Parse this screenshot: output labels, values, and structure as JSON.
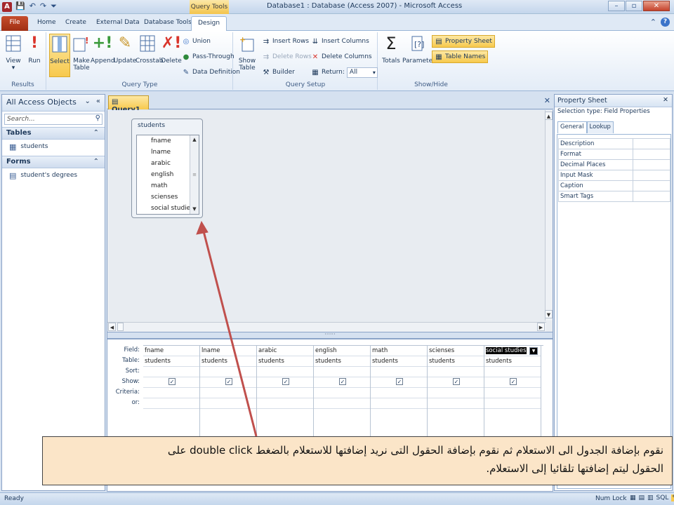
{
  "titlebar": {
    "app_icon": "A",
    "contextual_tab": "Query Tools",
    "title": "Database1 : Database (Access 2007)  -  Microsoft Access",
    "minimize": "–",
    "maximize": "▫",
    "close": "✕"
  },
  "tabs": {
    "file": "File",
    "home": "Home",
    "create": "Create",
    "external": "External Data",
    "dbtools": "Database Tools",
    "design": "Design"
  },
  "ribbon": {
    "results": {
      "label": "Results",
      "view": "View",
      "run": "Run"
    },
    "query_type": {
      "label": "Query Type",
      "select": "Select",
      "make_table_1": "Make",
      "make_table_2": "Table",
      "append": "Append",
      "update": "Update",
      "crosstab": "Crosstab",
      "delete": "Delete",
      "union": "Union",
      "pass_through": "Pass-Through",
      "data_definition": "Data Definition"
    },
    "query_setup": {
      "label": "Query Setup",
      "show_table_1": "Show",
      "show_table_2": "Table",
      "insert_rows": "Insert Rows",
      "delete_rows": "Delete Rows",
      "builder": "Builder",
      "insert_columns": "Insert Columns",
      "delete_columns": "Delete Columns",
      "return_label": "Return:",
      "return_value": "All"
    },
    "show_hide": {
      "label": "Show/Hide",
      "totals": "Totals",
      "parameters": "Parameters",
      "property_sheet": "Property Sheet",
      "table_names": "Table Names"
    }
  },
  "nav": {
    "title": "All Access Objects",
    "search_placeholder": "Search...",
    "groups": [
      {
        "name": "Tables",
        "items": [
          "students"
        ]
      },
      {
        "name": "Forms",
        "items": [
          "student's degrees"
        ]
      }
    ]
  },
  "query": {
    "tab_label": "Query1",
    "table_name": "students",
    "fields": [
      "fname",
      "lname",
      "arabic",
      "english",
      "math",
      "scienses",
      "social studies"
    ],
    "row_labels": [
      "Field:",
      "Table:",
      "Sort:",
      "Show:",
      "Criteria:",
      "or:"
    ],
    "columns": [
      {
        "field": "fname",
        "table": "students",
        "show": true
      },
      {
        "field": "lname",
        "table": "students",
        "show": true
      },
      {
        "field": "arabic",
        "table": "students",
        "show": true
      },
      {
        "field": "english",
        "table": "students",
        "show": true
      },
      {
        "field": "math",
        "table": "students",
        "show": true
      },
      {
        "field": "scienses",
        "table": "students",
        "show": true
      },
      {
        "field": "social studies",
        "table": "students",
        "show": true
      }
    ],
    "check_mark": "✓"
  },
  "property_sheet": {
    "title": "Property Sheet",
    "selection_type": "Selection type:  Field Properties",
    "tabs": [
      "General",
      "Lookup"
    ],
    "properties": [
      "Description",
      "Format",
      "Decimal Places",
      "Input Mask",
      "Caption",
      "Smart Tags"
    ]
  },
  "status": {
    "left": "Ready",
    "num_lock": "Num Lock"
  },
  "annotation": {
    "line1": "نقوم بإضافة الجدول الى الاستعلام ثم نقوم بإضافة الحقول التى نريد إضافتها للاستعلام بالضغط double click على",
    "line2": "الحقول ليتم إضافتها تلقائيا إلى الاستعلام."
  },
  "colors": {
    "accent": "#c0504d",
    "selected": "#f7c94d",
    "file_tab": "#b13c1e"
  }
}
